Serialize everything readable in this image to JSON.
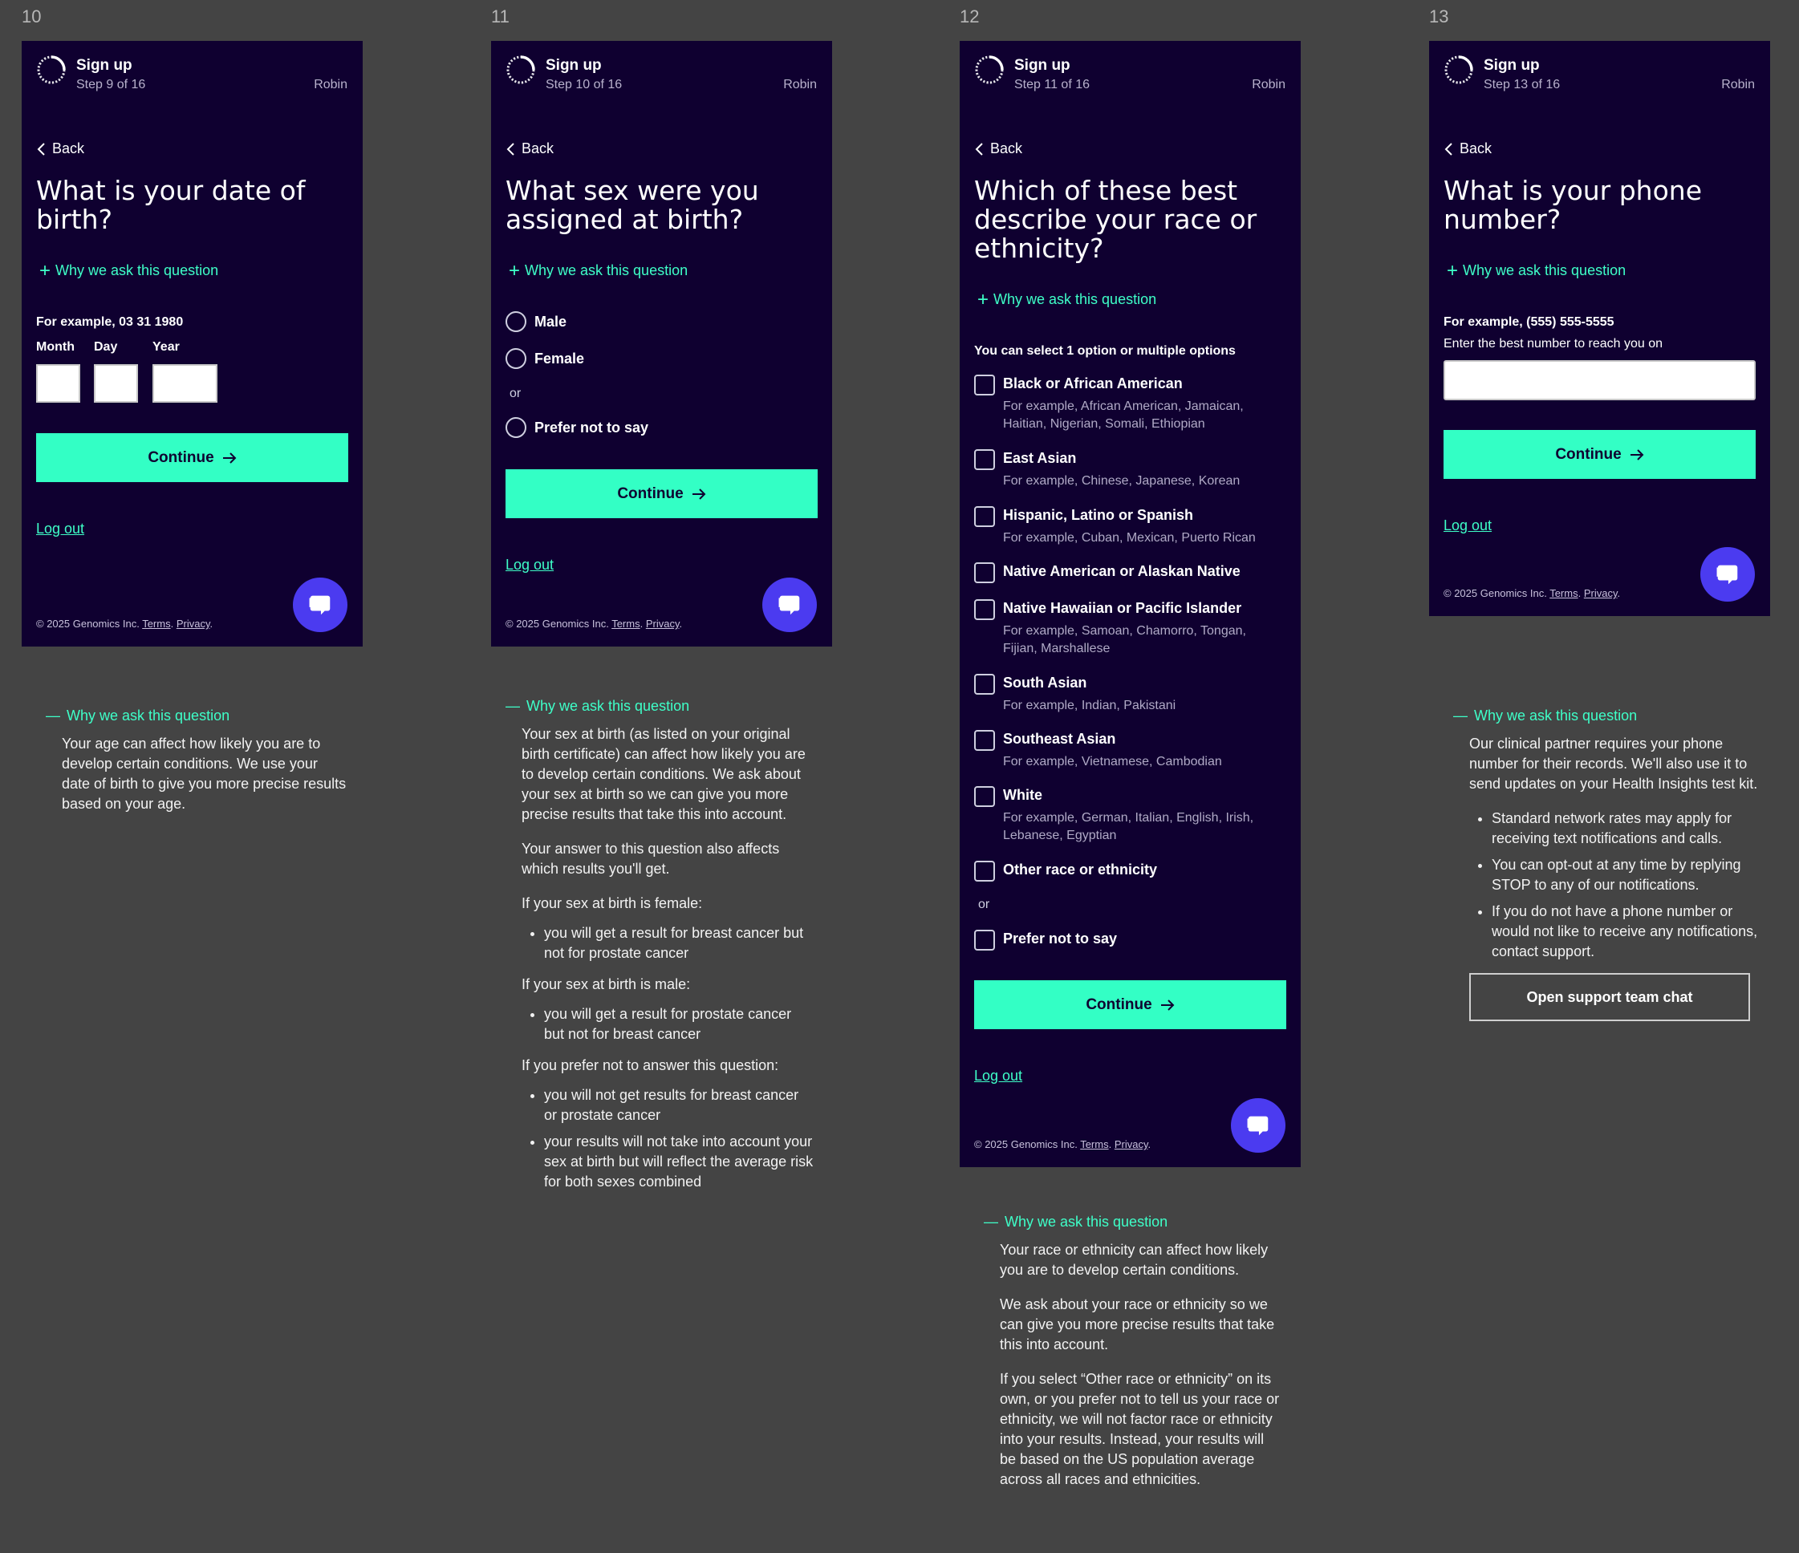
{
  "frames": [
    "10",
    "11",
    "12",
    "13"
  ],
  "common": {
    "title": "Sign up",
    "user": "Robin",
    "back": "Back",
    "why": "Why we ask this question",
    "continue": "Continue",
    "logout": "Log out",
    "copyright": "© 2025 Genomics Inc.",
    "terms": "Terms",
    "privacy": "Privacy"
  },
  "s1": {
    "step": "Step 9 of 16",
    "question": "What is your date of birth?",
    "example": "For example, 03 31 1980",
    "month": "Month",
    "day": "Day",
    "year": "Year",
    "month_value": "",
    "day_value": "",
    "year_value": ""
  },
  "s2": {
    "step": "Step 10 of 16",
    "question": "What sex were you assigned at birth?",
    "options": [
      "Male",
      "Female"
    ],
    "or": "or",
    "prefer": "Prefer not to say"
  },
  "s3": {
    "step": "Step 11 of 16",
    "question": "Which of these best describe your race or ethnicity?",
    "instruction": "You can select 1 option or multiple options",
    "options": [
      {
        "label": "Black or African American",
        "example": "For example, African American, Jamaican, Haitian, Nigerian, Somali, Ethiopian"
      },
      {
        "label": "East Asian",
        "example": "For example, Chinese, Japanese, Korean"
      },
      {
        "label": "Hispanic, Latino or Spanish",
        "example": "For example, Cuban, Mexican, Puerto Rican"
      },
      {
        "label": "Native American or Alaskan Native",
        "example": ""
      },
      {
        "label": "Native Hawaiian or Pacific Islander",
        "example": "For example, Samoan, Chamorro, Tongan, Fijian, Marshallese"
      },
      {
        "label": "South Asian",
        "example": "For example, Indian, Pakistani"
      },
      {
        "label": "Southeast Asian",
        "example": "For example, Vietnamese, Cambodian"
      },
      {
        "label": "White",
        "example": "For example, German, Italian, English, Irish, Lebanese, Egyptian"
      },
      {
        "label": "Other race or ethnicity",
        "example": ""
      }
    ],
    "or": "or",
    "prefer": "Prefer not to say"
  },
  "s4": {
    "step": "Step 13 of 16",
    "question": "What is your phone number?",
    "example": "For example, (555) 555-5555",
    "hint": "Enter the best number to reach you on",
    "phone_value": ""
  },
  "e1": {
    "heading": "Why we ask this question",
    "body": "Your age can affect how likely you are to develop certain conditions. We use your date of birth to give you more precise results based on your age."
  },
  "e2": {
    "heading": "Why we ask this question",
    "p1": "Your sex at birth (as listed on your original birth certificate) can affect how likely you are to develop certain conditions. We ask about your sex at birth so we can give you more precise results that take this into account.",
    "p2": "Your answer to this question also affects which results you'll get.",
    "female_h": "If your sex at birth is female:",
    "female_li": "you will get a result for breast cancer but not for prostate cancer",
    "male_h": "If your sex at birth is male:",
    "male_li": "you will get a result for prostate cancer but not for breast cancer",
    "prefer_h": "If you prefer not to answer this question:",
    "prefer_li1": "you will not get results for breast cancer or prostate cancer",
    "prefer_li2": "your results will not take into account your sex at birth but will reflect the average risk for both sexes combined"
  },
  "e3": {
    "heading": "Why we ask this question",
    "p1": "Your race or ethnicity can affect how likely you are to develop certain conditions.",
    "p2": "We ask about your race or ethnicity so we can give you more precise results that take this into account.",
    "p3": "If you select “Other race or ethnicity” on its own, or you prefer not to tell us your race or ethnicity, we will not factor race or ethnicity into your results. Instead, your results will be based on the US population average across all races and ethnicities."
  },
  "e4": {
    "heading": "Why we ask this question",
    "p1": "Our clinical partner requires your phone number for their records. We'll also use it to send updates on your Health Insights test kit.",
    "li1": "Standard network rates may apply for receiving text notifications and calls.",
    "li2": "You can opt-out at any time by replying STOP to any of our notifications.",
    "li3": "If you do not have a phone number or would not like to receive any notifications, contact support.",
    "button": "Open support team chat"
  }
}
